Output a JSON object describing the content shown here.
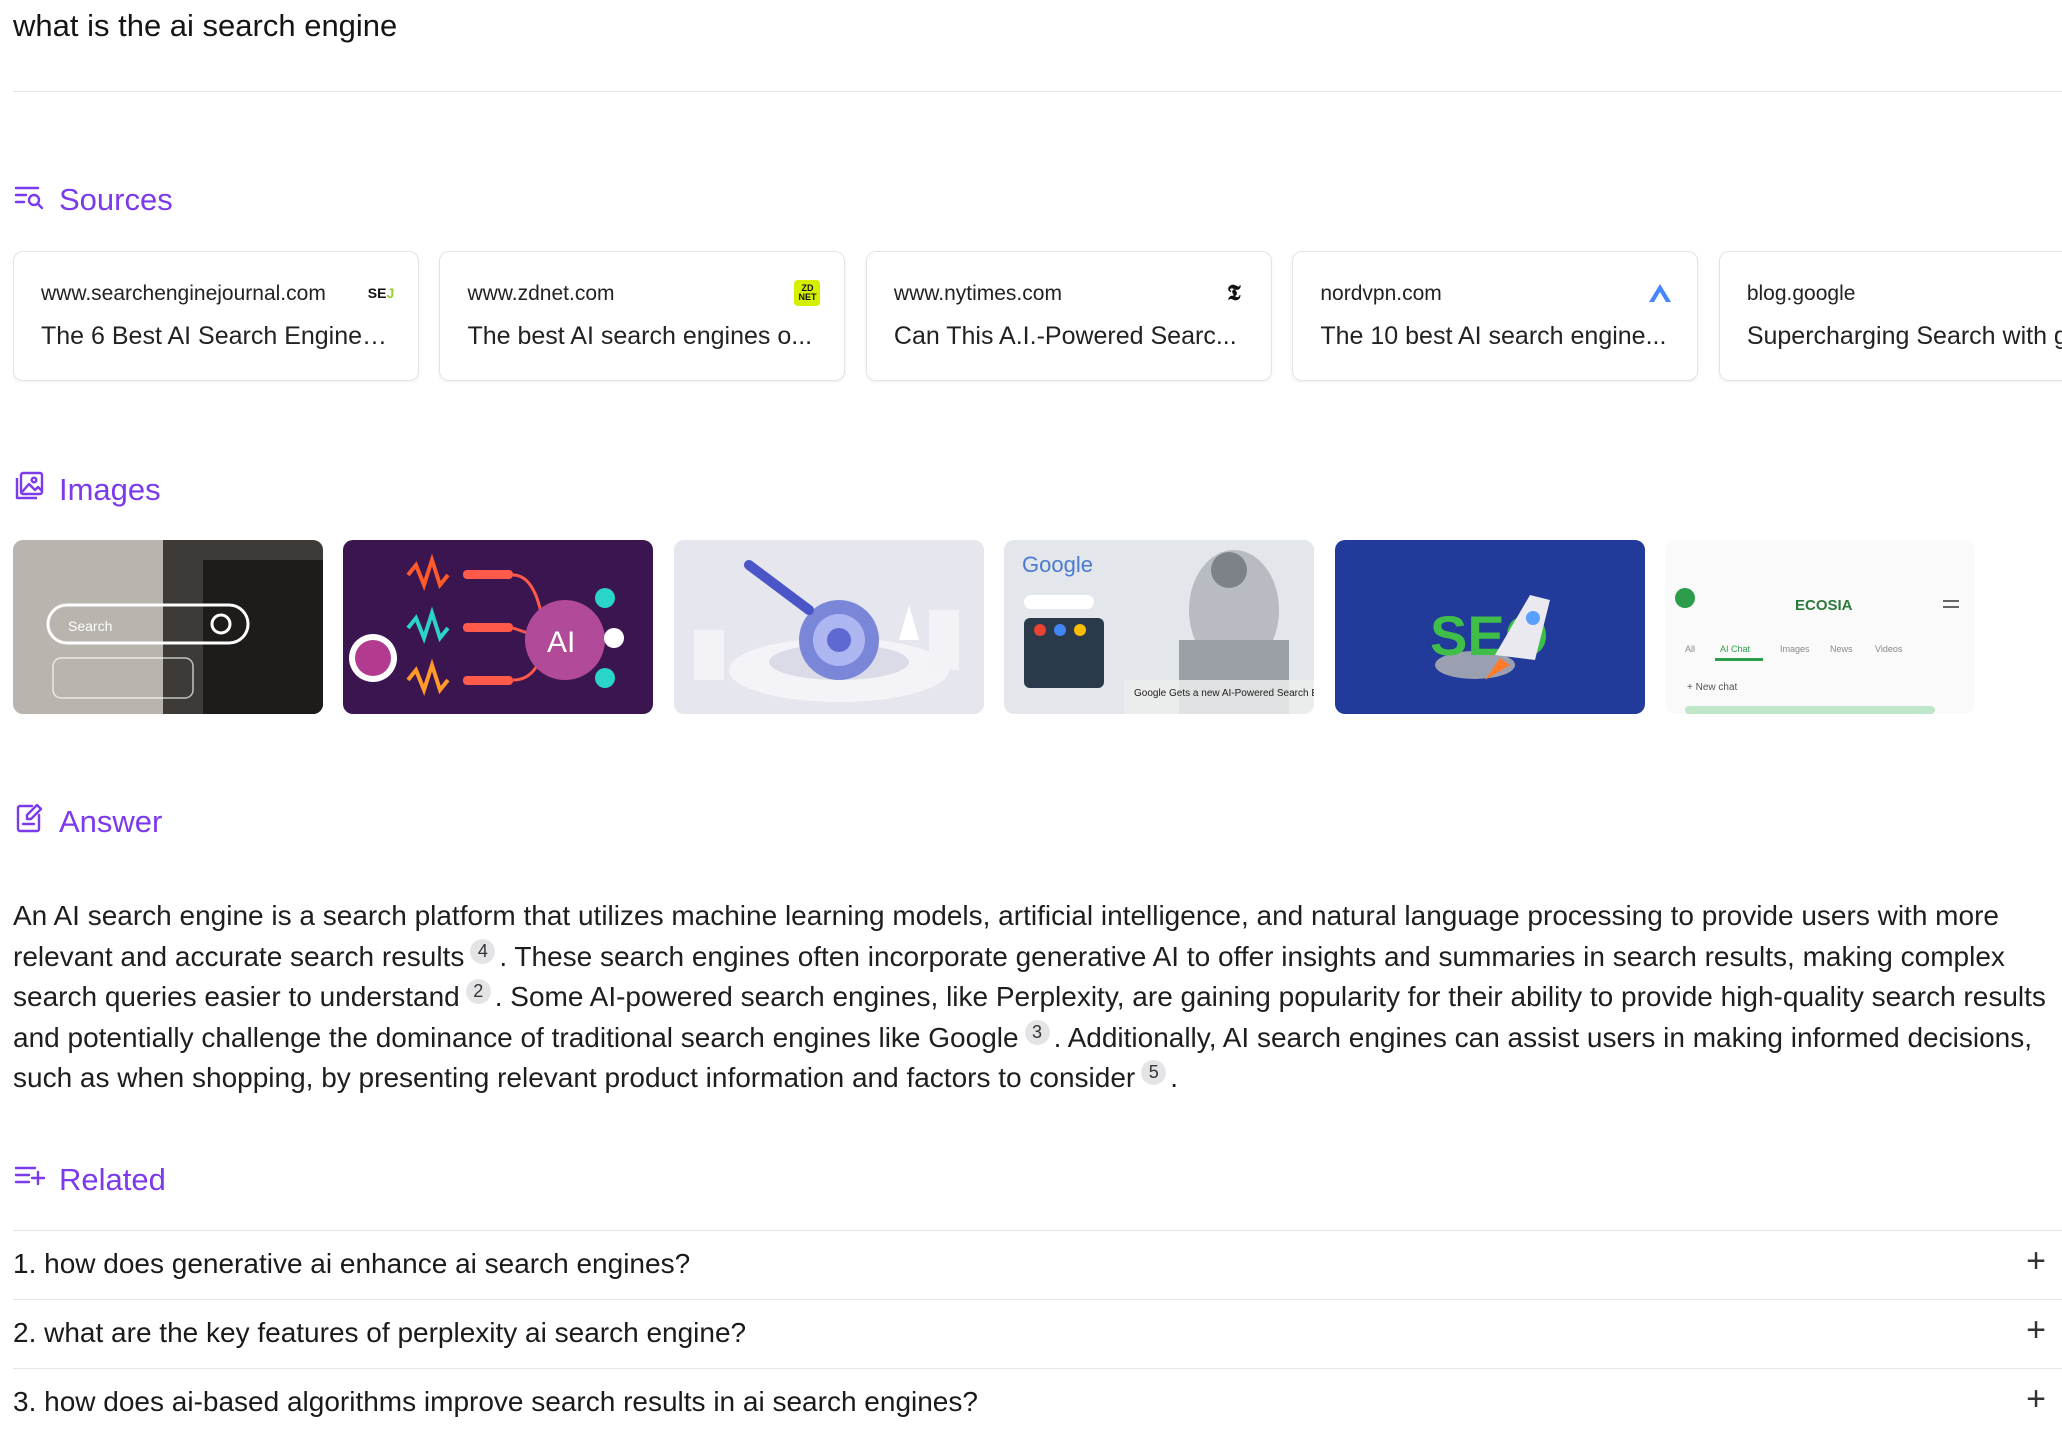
{
  "query": "what is the ai search engine",
  "sections": {
    "sources": "Sources",
    "images": "Images",
    "answer": "Answer",
    "related": "Related"
  },
  "sources": [
    {
      "domain": "www.searchenginejournal.com",
      "title": "The 6 Best AI Search Engines...",
      "icon": "SEJ"
    },
    {
      "domain": "www.zdnet.com",
      "title": "The best AI search engines o...",
      "icon": "ZD NET"
    },
    {
      "domain": "www.nytimes.com",
      "title": "Can This A.I.-Powered Searc...",
      "icon": "𝕿"
    },
    {
      "domain": "nordvpn.com",
      "title": "The 10 best AI search engine...",
      "icon": "nordvpn-logo"
    },
    {
      "domain": "blog.google",
      "title": "Supercharging Search with g...",
      "icon": "google-logo"
    }
  ],
  "images": [
    {
      "name": "search-bar-hand-image"
    },
    {
      "name": "ai-mindmap-image",
      "label": "AI"
    },
    {
      "name": "magnifier-3d-image"
    },
    {
      "name": "google-robot-image",
      "label": "Google",
      "caption": "Google Gets a new AI-Powered Search Engine"
    },
    {
      "name": "seo-rocket-image",
      "label": "SEO"
    },
    {
      "name": "ecosia-app-image",
      "label": "ECOSIA",
      "tabs": [
        "All",
        "AI Chat",
        "Images",
        "News",
        "Videos"
      ],
      "button": "+ New chat"
    }
  ],
  "answer": {
    "parts": [
      {
        "text": "An AI search engine is a search platform that utilizes machine learning models, artificial intelligence, and natural language processing to provide users with more relevant and accurate search results",
        "cite": "4"
      },
      {
        "text": ". These search engines often incorporate generative AI to offer insights and summaries in search results, making complex search queries easier to understand",
        "cite": "2"
      },
      {
        "text": ". Some AI-powered search engines, like Perplexity, are gaining popularity for their ability to provide high-quality search results and potentially challenge the dominance of traditional search engines like Google",
        "cite": "3"
      },
      {
        "text": ". Additionally, AI search engines can assist users in making informed decisions, such as when shopping, by presenting relevant product information and factors to consider",
        "cite": "5"
      },
      {
        "text": "."
      }
    ]
  },
  "related": [
    "1. how does generative ai enhance ai search engines?",
    "2. what are the key features of perplexity ai search engine?",
    "3. how does ai-based algorithms improve search results in ai search engines?"
  ],
  "colors": {
    "accent": "#7c3aed",
    "text": "#1a1a1a",
    "divider": "#e6e6e6",
    "citation_bg": "#e4e4e7"
  }
}
